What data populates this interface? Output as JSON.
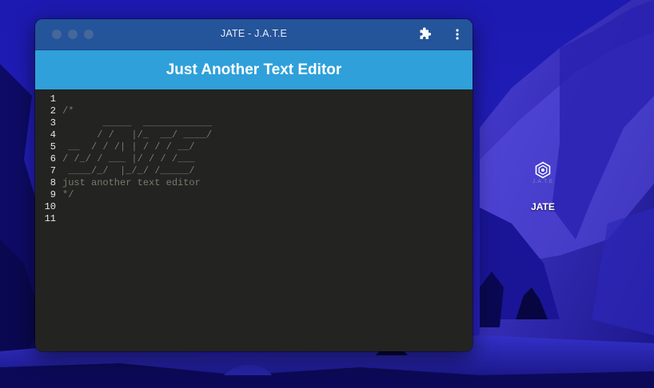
{
  "window": {
    "title": "JATE - J.A.T.E"
  },
  "app": {
    "header_title": "Just Another Text Editor"
  },
  "editor": {
    "lines": [
      {
        "number": "1",
        "text": ""
      },
      {
        "number": "2",
        "text": "/*"
      },
      {
        "number": "3",
        "text": "       _____  ____________"
      },
      {
        "number": "4",
        "text": "      / /   |/_  __/ ____/"
      },
      {
        "number": "5",
        "text": " __  / / /| | / / / __/"
      },
      {
        "number": "6",
        "text": "/ /_/ / ___ |/ / / /___"
      },
      {
        "number": "7",
        "text": " ____/_/  |_/_/ /_____/"
      },
      {
        "number": "8",
        "text": "just another text editor"
      },
      {
        "number": "9",
        "text": "*/"
      },
      {
        "number": "10",
        "text": ""
      },
      {
        "number": "11",
        "text": ""
      }
    ]
  },
  "desktop_icon": {
    "logo_text": "J.A.T.E",
    "label": "JATE"
  },
  "icons": {
    "extensions": "puzzle-piece-icon",
    "menu": "kebab-menu-icon",
    "app_logo": "jate-logo-icon"
  },
  "colors": {
    "titlebar": "#24549a",
    "app_header": "#2fa0da",
    "editor_background": "#232321",
    "comment_text": "#7a7a6c",
    "line_numbers": "#e6e6e6",
    "desktop_background": "#1a1aa8"
  }
}
